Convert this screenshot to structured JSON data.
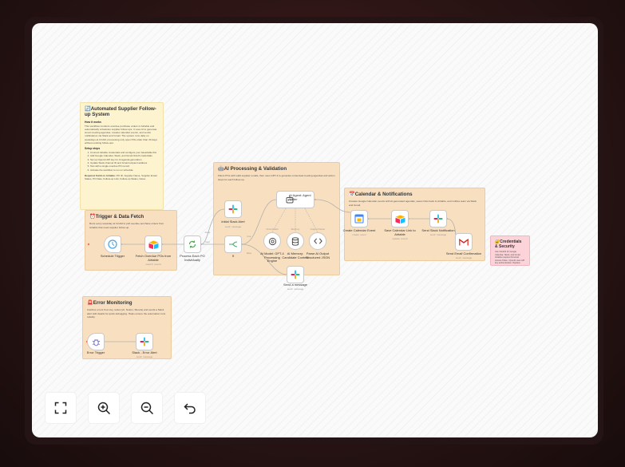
{
  "stickies": {
    "main": {
      "title": "🔄Automated Supplier Follow-up System",
      "how_heading": "How it works",
      "how_text": "This workflow monitors overdue purchase orders in Airtable and automatically schedules supplier follow-ups. It uses AI to generate smart meeting agendas, creates calendar events, and sends notifications via Slack and Gmail. The system runs daily on weekdays at 10 AM, processing only open POs older than 30 days without existing follow-ups.",
      "setup_heading": "Setup steps",
      "setup_steps": [
        "Connect Airtable credentials and configure your base/table IDs",
        "Add Google Calendar, Slack, and Gmail OAuth credentials",
        "Set up OpenAI API key for AI agenda generation",
        "Update Slack channel ID and Gmail recipient address",
        "Test with a single overdue PO record",
        "Activate the workflow to run on schedule"
      ],
      "required_label": "Required Fields in Airtable:",
      "required_text": "PO ID, Supplier Name, Supplier Email, Status, PO Date, Follow-up Link, Follow-up Status, Notes"
    },
    "trigger": {
      "title": "⏰Trigger & Data Fetch",
      "text": "Runs every weekday at 10 AM to pull overdue purchase orders from Airtable that need supplier follow-up."
    },
    "ai": {
      "title": "🤖AI Processing & Validation",
      "text": "Filters POs with valid supplier emails, then uses GPT-4 to generate contextual meeting agendas and action steps for each follow-up."
    },
    "calendar": {
      "title": "📅Calendar & Notifications",
      "text": "Creates Google Calendar events with AI-generated agendas, saves links back to Airtable, and notifies team via Slack and Gmail."
    },
    "credentials": {
      "title": "🔐Credentials & Security",
      "text": "Use OAuth2 for Google Calendar, Slack, and Gmail. Airtable requires Personal Access Token. OpenAI uses API key authentication. Replace email-hidden@placeholder.com with your actual recipient address before deploying."
    },
    "error": {
      "title": "🚨Error Monitoring",
      "text": "Catches errors from key nodes (AI, Notion, Sheets) and sends a Slack alert with details for quick debugging. Helps ensure the automation runs reliably."
    }
  },
  "nodes": {
    "schedule": {
      "label": "Schedule Trigger",
      "icon": "clock-icon"
    },
    "fetch": {
      "label": "Fetch Overdue POs from Airtable",
      "sub": "search: record",
      "icon": "airtable-icon"
    },
    "loop": {
      "label": "Process Each PO Individually",
      "icon": "loop-icon"
    },
    "slack_init": {
      "label": "Initial Slack Alert",
      "sub": "send: message",
      "icon": "slack-icon"
    },
    "if": {
      "label": "If",
      "icon": "if-icon"
    },
    "agent": {
      "label": "AI Agent: Agent Writer",
      "icon": "robot-icon"
    },
    "model": {
      "label": "AI Model: GPT-4 Processing Engine",
      "icon": "openai-icon"
    },
    "memory": {
      "label": "AI Memory: Candidate Context",
      "icon": "database-icon"
    },
    "parser": {
      "label": "Parse AI Output Structured JSON",
      "icon": "code-icon"
    },
    "slack_msg": {
      "label": "Send a message",
      "sub": "send: message",
      "icon": "slack-icon"
    },
    "calendar": {
      "label": "Create Calendar Event",
      "sub": "create: event",
      "icon": "calendar-icon"
    },
    "save": {
      "label": "Save Calendar Link to Airtable",
      "sub": "update: record",
      "icon": "airtable-icon"
    },
    "slack_notif": {
      "label": "Send Slack Notification",
      "sub": "send: message",
      "icon": "slack-icon"
    },
    "gmail": {
      "label": "Send Email Confirmation",
      "sub": "send: message",
      "icon": "gmail-icon"
    },
    "error_trigger": {
      "label": "Error Trigger",
      "icon": "bug-icon"
    },
    "slack_error": {
      "label": "Slack - Error Alert",
      "sub": "send: message",
      "icon": "slack-icon"
    }
  },
  "connector_labels": {
    "true": "true",
    "false": "false",
    "done": "done",
    "loop": "loop",
    "chat_model": "Chat Model",
    "memory": "Memory",
    "output_parser": "Output Parser"
  },
  "controls": [
    {
      "name": "fit-view",
      "icon": "fit-screen-icon"
    },
    {
      "name": "zoom-in",
      "icon": "zoom-in-icon"
    },
    {
      "name": "zoom-out",
      "icon": "zoom-out-icon"
    },
    {
      "name": "undo",
      "icon": "undo-icon"
    }
  ],
  "colors": {
    "slack": "#e01e5a",
    "airtable": "#fcb400",
    "gmail": "#ea4335",
    "calendar": "#4285f4",
    "loop": "#4caf50",
    "accent": "#ff6d5a"
  }
}
